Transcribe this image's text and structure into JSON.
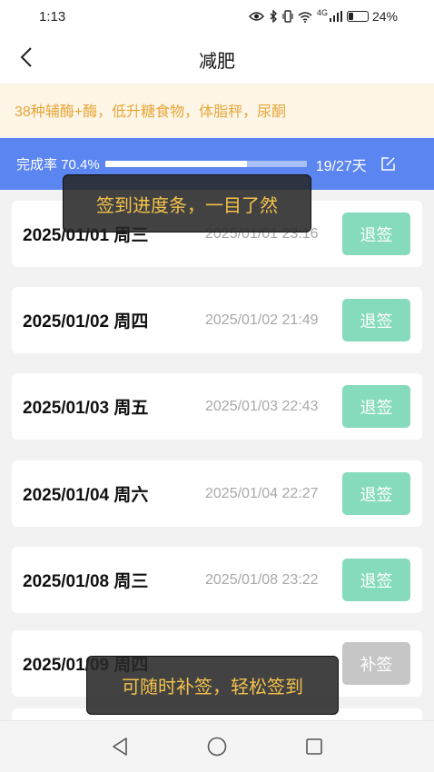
{
  "status_bar": {
    "time": "1:13",
    "network": "4G",
    "battery": "24%"
  },
  "header": {
    "title": "减肥"
  },
  "notice": {
    "text": "38种辅酶+酶，低升糖食物，体脂秤，尿酮"
  },
  "progress": {
    "label": "完成率 70.4%",
    "fraction": 0.704,
    "days": "19/27天"
  },
  "records": [
    {
      "date": "2025/01/01 周三",
      "time": "2025/01/01 23:16",
      "action": "退签"
    },
    {
      "date": "2025/01/02 周四",
      "time": "2025/01/02 21:49",
      "action": "退签"
    },
    {
      "date": "2025/01/03 周五",
      "time": "2025/01/03 22:43",
      "action": "退签"
    },
    {
      "date": "2025/01/04 周六",
      "time": "2025/01/04 22:27",
      "action": "退签"
    },
    {
      "date": "2025/01/08 周三",
      "time": "2025/01/08 23:22",
      "action": "退签"
    },
    {
      "date": "2025/01/09 周四",
      "time": "",
      "action": "补签"
    }
  ],
  "tooltips": {
    "progress": "签到进度条，一目了然",
    "makeup": "可随时补签，轻松签到"
  },
  "colors": {
    "primary": "#5b85f0",
    "cancel": "#86dbbc",
    "makeup": "#c6c6c6",
    "notice_text": "#e8a53a",
    "tooltip_text": "#f4c24b"
  },
  "icons": {
    "back": "chevron-left-icon",
    "edit": "edit-icon",
    "sys_back": "triangle-back-icon",
    "sys_home": "circle-home-icon",
    "sys_recent": "square-recent-icon"
  }
}
